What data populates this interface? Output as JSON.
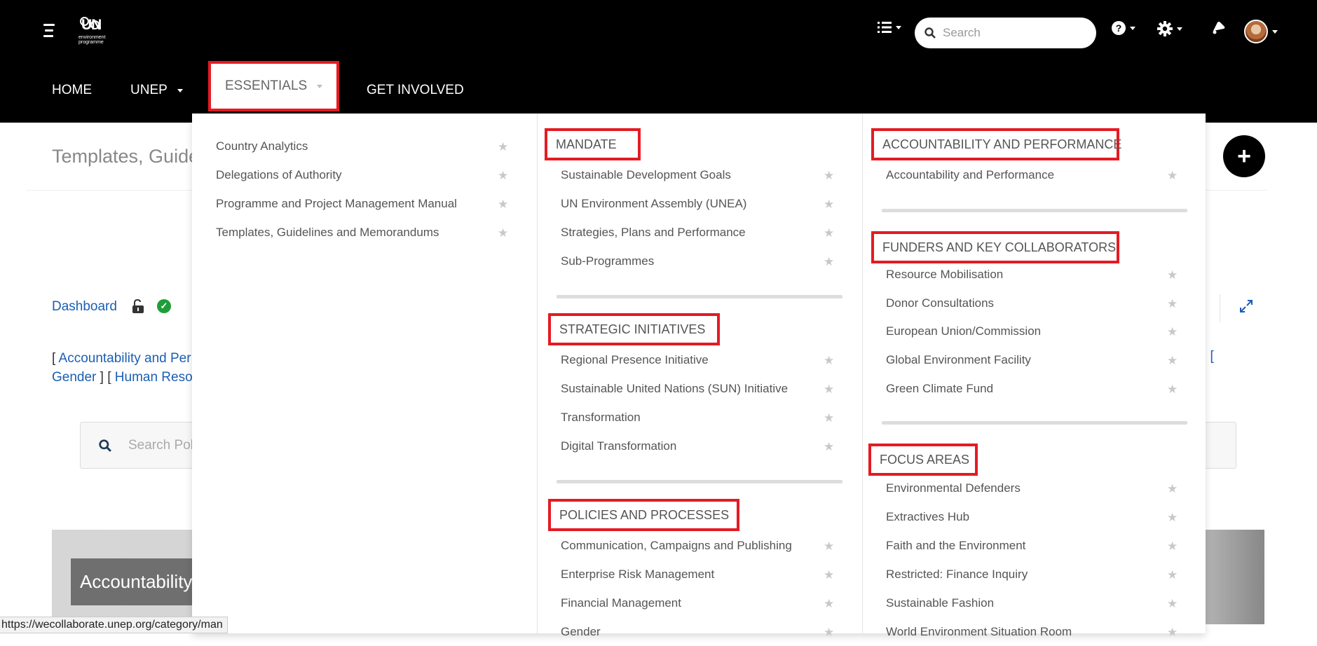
{
  "header": {
    "logo_text": "UN",
    "logo_sub": "environment programme",
    "search_placeholder": "Search"
  },
  "nav": {
    "home": "HOME",
    "unep": "UNEP",
    "essentials": "ESSENTIALS",
    "get_involved": "GET INVOLVED"
  },
  "page": {
    "title": "Templates, Guide",
    "dashboard": "Dashboard",
    "link1_open": "[ ",
    "link1": "Accountability and Per",
    "link2": "Gender",
    "link2_sep": " ] [ ",
    "link3": "Human Reso",
    "right_brackets": "] [",
    "policy_search_placeholder": "Search Poli",
    "card_title": "Accountability",
    "status_url": "https://wecollaborate.unep.org/category/man"
  },
  "menu": {
    "col1": [
      "Country Analytics",
      "Delegations of Authority",
      "Programme and Project Management Manual",
      "Templates, Guidelines and Memorandums"
    ],
    "mandate": {
      "heading": "MANDATE",
      "items": [
        "Sustainable Development Goals",
        "UN Environment Assembly (UNEA)",
        "Strategies, Plans and Performance",
        "Sub-Programmes"
      ]
    },
    "strategic": {
      "heading": "STRATEGIC INITIATIVES",
      "items": [
        "Regional Presence Initiative",
        "Sustainable United Nations (SUN) Initiative",
        "Transformation",
        "Digital Transformation"
      ]
    },
    "policies": {
      "heading": "POLICIES AND PROCESSES",
      "items": [
        "Communication, Campaigns and Publishing",
        "Enterprise Risk Management",
        "Financial Management",
        "Gender"
      ]
    },
    "accountability": {
      "heading": "ACCOUNTABILITY AND PERFORMANCE",
      "items": [
        "Accountability and Performance"
      ]
    },
    "funders": {
      "heading": "FUNDERS AND KEY COLLABORATORS",
      "items": [
        "Resource Mobilisation",
        "Donor Consultations",
        "European Union/Commission",
        "Global Environment Facility",
        "Green Climate Fund"
      ]
    },
    "focus": {
      "heading": "FOCUS AREAS",
      "items": [
        "Environmental Defenders",
        "Extractives Hub",
        "Faith and the Environment",
        "Restricted: Finance Inquiry",
        "Sustainable Fashion",
        "World Environment Situation Room"
      ]
    }
  },
  "colors": {
    "highlight": "#e41b23",
    "link": "#1a5fb4",
    "header_bg": "#000000"
  }
}
